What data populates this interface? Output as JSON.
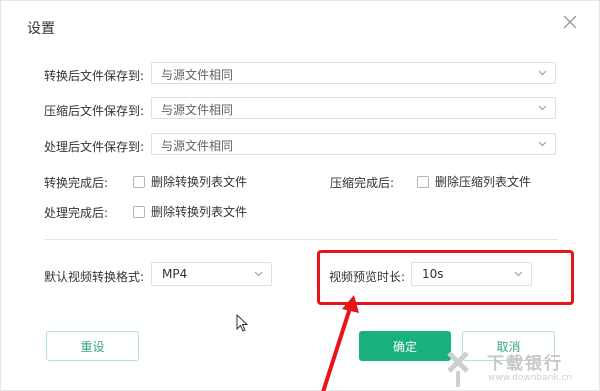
{
  "dialog": {
    "title": "设置"
  },
  "save_paths": [
    {
      "label": "转换后文件保存到:",
      "value": "与源文件相同"
    },
    {
      "label": "压缩后文件保存到:",
      "value": "与源文件相同"
    },
    {
      "label": "处理后文件保存到:",
      "value": "与源文件相同"
    }
  ],
  "after_convert": {
    "label": "转换完成后:",
    "option": "删除转换列表文件",
    "checked": false
  },
  "after_compress": {
    "label": "压缩完成后:",
    "option": "删除压缩列表文件",
    "checked": false
  },
  "after_process": {
    "label": "处理完成后:",
    "option": "删除转换列表文件",
    "checked": false
  },
  "default_format": {
    "label": "默认视频转换格式:",
    "value": "MP4"
  },
  "preview_duration": {
    "label": "视频预览时长:",
    "value": "10s"
  },
  "buttons": {
    "reset": "重设",
    "ok": "确定",
    "cancel": "取消"
  },
  "watermark": {
    "name": "下载银行",
    "url": "www.downbank.cn"
  },
  "colors": {
    "primary": "#18b07b",
    "annotation": "#e8141c"
  }
}
